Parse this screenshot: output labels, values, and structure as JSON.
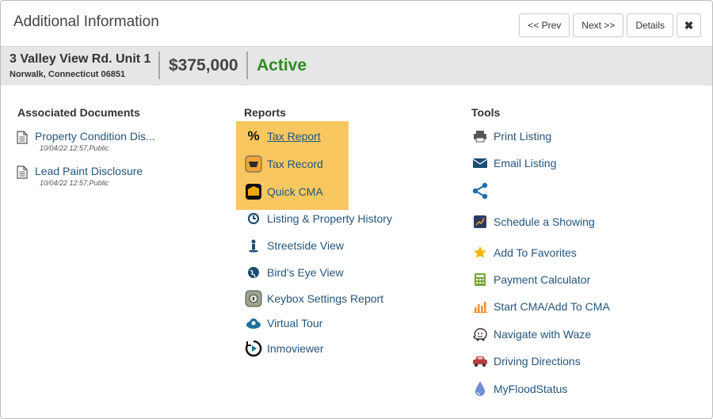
{
  "header": {
    "title": "Additional Information",
    "prev_label": "<< Prev",
    "next_label": "Next >>",
    "details_label": "Details",
    "close_label": "✖"
  },
  "listing": {
    "address_line1": "3 Valley View Rd. Unit 1",
    "address_line2": "Norwalk, Connecticut 06851",
    "price": "$375,000",
    "status": "Active",
    "status_color": "#2e8b22"
  },
  "documents": {
    "heading": "Associated Documents",
    "items": [
      {
        "label": "Property Condition Dis...",
        "meta": "10/04/22 12:57,Public"
      },
      {
        "label": "Lead Paint Disclosure",
        "meta": "10/04/22 12:57,Public"
      }
    ]
  },
  "reports": {
    "heading": "Reports",
    "highlight_color": "#f8c760",
    "items": [
      {
        "label": "Tax Report",
        "icon": "percent-icon"
      },
      {
        "label": "Tax Record",
        "icon": "tax-record-icon"
      },
      {
        "label": "Quick CMA",
        "icon": "quick-cma-icon"
      },
      {
        "label": "Listing & Property History",
        "icon": "history-icon"
      },
      {
        "label": "Streetside View",
        "icon": "street-person-icon"
      },
      {
        "label": "Bird's Eye View",
        "icon": "globe-icon"
      },
      {
        "label": "Keybox Settings Report",
        "icon": "keybox-icon"
      },
      {
        "label": "Virtual Tour",
        "icon": "virtual-tour-icon"
      },
      {
        "label": "Inmoviewer",
        "icon": "play-circle-icon"
      }
    ]
  },
  "tools": {
    "heading": "Tools",
    "items": [
      {
        "label": "Print Listing",
        "icon": "printer-icon"
      },
      {
        "label": "Email Listing",
        "icon": "envelope-icon"
      },
      {
        "label": "",
        "icon": "share-icon"
      },
      {
        "label": "Schedule a Showing",
        "icon": "schedule-showing-icon"
      },
      {
        "label": "Add To Favorites",
        "icon": "star-icon"
      },
      {
        "label": "Payment Calculator",
        "icon": "calculator-icon"
      },
      {
        "label": "Start CMA/Add To CMA",
        "icon": "bar-chart-icon"
      },
      {
        "label": "Navigate with Waze",
        "icon": "waze-icon"
      },
      {
        "label": "Driving Directions",
        "icon": "car-icon"
      },
      {
        "label": "MyFloodStatus",
        "icon": "water-drop-icon"
      }
    ]
  }
}
